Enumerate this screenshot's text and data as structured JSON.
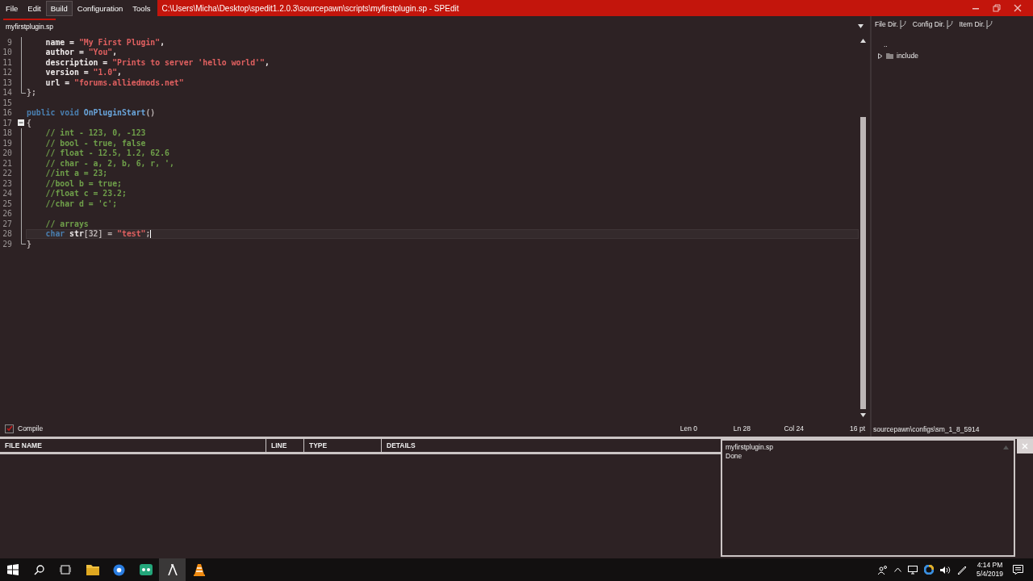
{
  "menu": [
    {
      "label": "File",
      "hovered": false
    },
    {
      "label": "Edit",
      "hovered": false
    },
    {
      "label": "Build",
      "hovered": true
    },
    {
      "label": "Configuration",
      "hovered": false
    },
    {
      "label": "Tools",
      "hovered": false
    }
  ],
  "title": "C:\\Users\\Micha\\Desktop\\spedit1.2.0.3\\sourcepawn\\scripts\\myfirstplugin.sp - SPEdit",
  "tabs": [
    {
      "label": "myfirstplugin.sp",
      "selected": true
    }
  ],
  "editor": {
    "lines": [
      {
        "number": "9",
        "kind": "bar",
        "current": false,
        "tokens": [
          {
            "kind": "text",
            "text": "    name = "
          },
          {
            "kind": "string",
            "text": "\"My First Plugin\""
          },
          {
            "kind": "text",
            "text": ","
          }
        ]
      },
      {
        "number": "10",
        "kind": "bar",
        "current": false,
        "tokens": [
          {
            "kind": "text",
            "text": "    author = "
          },
          {
            "kind": "string",
            "text": "\"You\""
          },
          {
            "kind": "text",
            "text": ","
          }
        ]
      },
      {
        "number": "11",
        "kind": "bar",
        "current": false,
        "tokens": [
          {
            "kind": "text",
            "text": "    description = "
          },
          {
            "kind": "string",
            "text": "\"Prints to server 'hello world'\""
          },
          {
            "kind": "text",
            "text": ","
          }
        ]
      },
      {
        "number": "12",
        "kind": "bar",
        "current": false,
        "tokens": [
          {
            "kind": "text",
            "text": "    version = "
          },
          {
            "kind": "string",
            "text": "\"1.0\""
          },
          {
            "kind": "text",
            "text": ","
          }
        ]
      },
      {
        "number": "13",
        "kind": "bar",
        "current": false,
        "tokens": [
          {
            "kind": "text",
            "text": "    url = "
          },
          {
            "kind": "string",
            "text": "\"forums.alliedmods.net\""
          }
        ]
      },
      {
        "number": "14",
        "kind": "end",
        "current": false,
        "tokens": [
          {
            "kind": "punct",
            "text": "};"
          }
        ]
      },
      {
        "number": "15",
        "kind": "none",
        "current": false
      },
      {
        "number": "16",
        "kind": "none",
        "current": false,
        "tokens": [
          {
            "kind": "keyword",
            "text": "public void "
          },
          {
            "kind": "function",
            "text": "OnPluginStart"
          },
          {
            "kind": "punct",
            "text": "()"
          }
        ]
      },
      {
        "number": "17",
        "kind": "toggle",
        "current": false,
        "tokens": [
          {
            "kind": "punct",
            "text": "{"
          }
        ]
      },
      {
        "number": "18",
        "kind": "bar",
        "current": false,
        "tokens": [
          {
            "kind": "comment",
            "text": "    // int - 123, 0, -123"
          }
        ]
      },
      {
        "number": "19",
        "kind": "bar",
        "current": false,
        "tokens": [
          {
            "kind": "comment",
            "text": "    // bool - true, false"
          }
        ]
      },
      {
        "number": "20",
        "kind": "bar",
        "current": false,
        "tokens": [
          {
            "kind": "comment",
            "text": "    // float - 12.5, 1.2, 62.6"
          }
        ]
      },
      {
        "number": "21",
        "kind": "bar",
        "current": false,
        "tokens": [
          {
            "kind": "comment",
            "text": "    // char - a, 2, b, 6, r, ',"
          }
        ]
      },
      {
        "number": "22",
        "kind": "bar",
        "current": false,
        "tokens": [
          {
            "kind": "comment",
            "text": "    //int a = 23;"
          }
        ]
      },
      {
        "number": "23",
        "kind": "bar",
        "current": false,
        "tokens": [
          {
            "kind": "comment",
            "text": "    //bool b = true;"
          }
        ]
      },
      {
        "number": "24",
        "kind": "bar",
        "current": false,
        "tokens": [
          {
            "kind": "comment",
            "text": "    //float c = 23.2;"
          }
        ]
      },
      {
        "number": "25",
        "kind": "bar",
        "current": false,
        "tokens": [
          {
            "kind": "comment",
            "text": "    //char d = 'c';"
          }
        ]
      },
      {
        "number": "26",
        "kind": "bar",
        "current": false
      },
      {
        "number": "27",
        "kind": "bar",
        "current": false,
        "tokens": [
          {
            "kind": "comment",
            "text": "    // arrays"
          }
        ]
      },
      {
        "number": "28",
        "kind": "bar",
        "current": true,
        "tokens": [
          {
            "kind": "keyword",
            "text": "    char "
          },
          {
            "kind": "text",
            "text": "str"
          },
          {
            "kind": "punct",
            "text": "[32] = "
          },
          {
            "kind": "string",
            "text": "\"test\""
          },
          {
            "kind": "punct",
            "text": ";"
          }
        ]
      },
      {
        "number": "29",
        "kind": "end",
        "current": false,
        "tokens": [
          {
            "kind": "punct",
            "text": "}"
          }
        ]
      }
    ]
  },
  "side_panel": {
    "tabs": [
      "File Dir.",
      "Config Dir.",
      "Item Dir."
    ],
    "tree": [
      {
        "kind": "parent",
        "label": ".."
      },
      {
        "kind": "folder",
        "label": "include",
        "expanded": false
      }
    ]
  },
  "status": {
    "compile": {
      "label": "Compile",
      "checked": true
    },
    "len": "Len 0",
    "ln": "Ln 28",
    "col": "Col 24",
    "font_size": "16 pt",
    "config_path": "sourcepawn\\configs\\sm_1_8_5914"
  },
  "errors_table": {
    "columns": [
      "FILE NAME",
      "LINE",
      "TYPE",
      "DETAILS"
    ]
  },
  "output": {
    "lines": [
      "myfirstplugin.sp",
      "Done"
    ]
  },
  "taskbar": {
    "apps": [
      {
        "kind": "files",
        "active": false
      },
      {
        "kind": "browser",
        "active": false
      },
      {
        "kind": "chat",
        "active": false
      },
      {
        "kind": "editor",
        "active": true
      },
      {
        "kind": "cone",
        "active": false
      }
    ],
    "time": "4:14 PM",
    "date": "5/4/2019"
  }
}
